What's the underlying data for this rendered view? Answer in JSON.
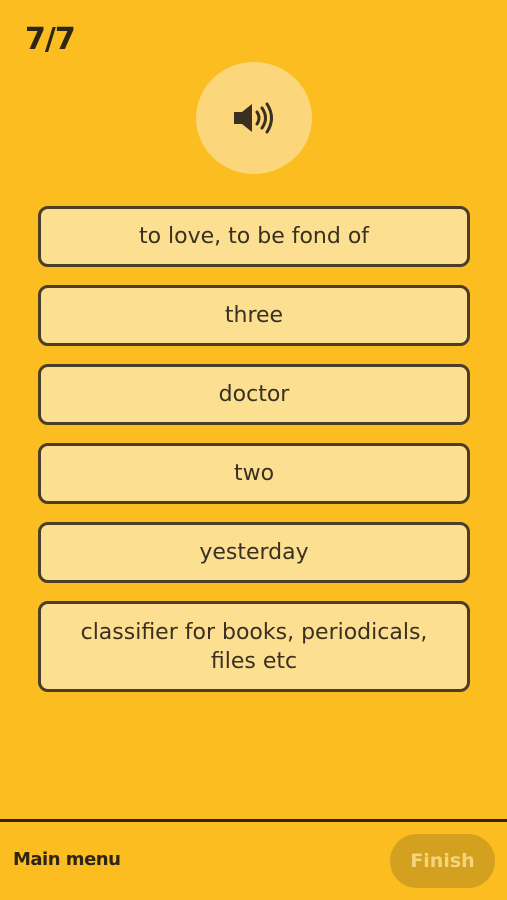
{
  "progress": {
    "label": "7/7"
  },
  "audio": {
    "icon": "speaker-icon"
  },
  "options": [
    {
      "label": "to love, to be fond of"
    },
    {
      "label": "three"
    },
    {
      "label": "doctor"
    },
    {
      "label": "two"
    },
    {
      "label": "yesterday"
    },
    {
      "label": "classifier for books, periodicals, files etc"
    }
  ],
  "footer": {
    "main_menu_label": "Main menu",
    "finish_label": "Finish"
  },
  "colors": {
    "background": "#FBBD1F",
    "option_fill": "#FDDF92",
    "option_border": "#4A3E28",
    "finish_disabled": "#D4A020"
  }
}
